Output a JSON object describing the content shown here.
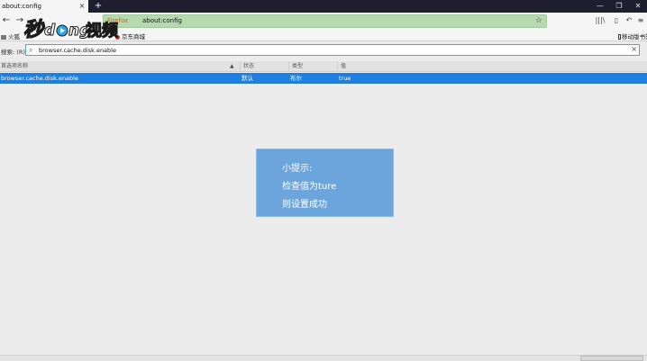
{
  "tab": {
    "title": "about:config",
    "close": "×",
    "new_tab": "+"
  },
  "window_controls": {
    "minimize": "—",
    "restore": "❐",
    "close": "✕"
  },
  "nav": {
    "back": "←",
    "forward": "→",
    "reload": "⟳",
    "home": "⌂"
  },
  "urlbar": {
    "identity": "Firefox",
    "url": "about:config",
    "star": "☆"
  },
  "toolbar_right": {
    "library": "|||\\",
    "sidebar": "▯",
    "undo": "↶",
    "menu": "≡"
  },
  "bookmarks": [
    {
      "label": "火狐",
      "icon": "folder-icon"
    },
    {
      "label": "京东商城",
      "icon": "shop-icon"
    }
  ],
  "bookmarks_right": {
    "label": "移动版书签",
    "icon": "mobile-icon"
  },
  "search": {
    "label": "搜索:",
    "shortcut": "(R)",
    "value": "browser.cache.disk.enable"
  },
  "table": {
    "headers": {
      "name": "首选项名称",
      "status": "状态",
      "type": "类型",
      "value": "值"
    },
    "rows": [
      {
        "name": "browser.cache.disk.enable",
        "status": "默认",
        "type": "布尔",
        "value": "true"
      }
    ]
  },
  "tip": {
    "line1": "小提示:",
    "line2": "检查值为ture",
    "line3": "则设置成功"
  },
  "logo": {
    "text": "秒懂视频"
  },
  "status": {
    "text": "",
    "button": ""
  },
  "colors": {
    "selected_row": "#1f7fe0",
    "tip_bg": "#6ca5dc",
    "urlbar_bg": "#b6d9b0",
    "tabbar_bg": "#1e1e2e"
  }
}
